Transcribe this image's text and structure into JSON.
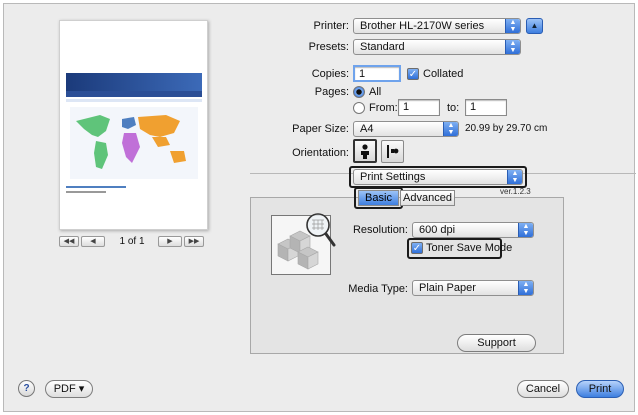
{
  "printer": {
    "label": "Printer:",
    "value": "Brother HL-2170W series"
  },
  "presets": {
    "label": "Presets:",
    "value": "Standard"
  },
  "copies": {
    "label": "Copies:",
    "value": "1",
    "collated_label": "Collated"
  },
  "pages": {
    "label": "Pages:",
    "all_label": "All",
    "from_label": "From:",
    "from_value": "1",
    "to_label": "to:",
    "to_value": "1"
  },
  "paper_size": {
    "label": "Paper Size:",
    "value": "A4",
    "dimensions": "20.99 by 29.70 cm"
  },
  "orientation": {
    "label": "Orientation:"
  },
  "section_popup": {
    "value": "Print Settings"
  },
  "version": "ver.1.2.3",
  "tabs": [
    {
      "label": "Basic"
    },
    {
      "label": "Advanced"
    }
  ],
  "resolution": {
    "label": "Resolution:",
    "value": "600 dpi"
  },
  "toner_save": {
    "label": "Toner Save Mode"
  },
  "media_type": {
    "label": "Media Type:",
    "value": "Plain Paper"
  },
  "support_label": "Support",
  "preview_nav": {
    "page_text": "1 of 1"
  },
  "footer": {
    "help": "?",
    "pdf_label": "PDF ▾",
    "cancel_label": "Cancel",
    "print_label": "Print"
  },
  "colors": {
    "accent": "#3d7fe0",
    "map_green": "#5fc47a",
    "map_orange": "#f0a030",
    "map_purple": "#c070d8",
    "map_blue": "#4f7fc0"
  }
}
